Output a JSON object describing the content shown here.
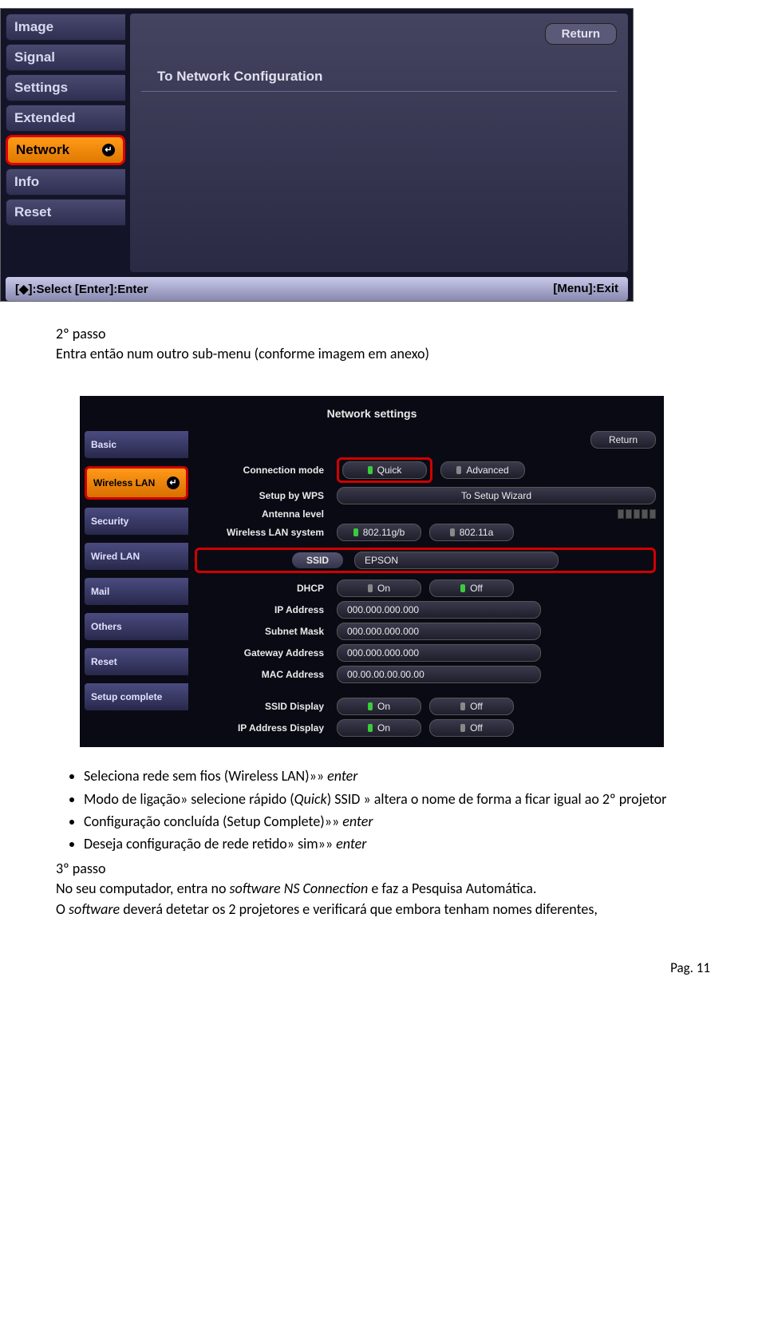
{
  "osd1": {
    "sidebar": [
      "Image",
      "Signal",
      "Settings",
      "Extended",
      "Network",
      "Info",
      "Reset"
    ],
    "selected_index": 4,
    "return_label": "Return",
    "to_network": "To Network Configuration",
    "footer_left": "[◆]:Select [Enter]:Enter",
    "footer_right": "[Menu]:Exit"
  },
  "doc": {
    "p2_title": "2º passo",
    "p2_line": "Entra então num outro sub-menu (conforme imagem em anexo)",
    "bullet1a": "Seleciona rede sem fios (Wireless LAN)»» ",
    "bullet1b": "enter",
    "bullet2a": "Modo de ligação» selecione rápido (",
    "bullet2b": "Quick",
    "bullet2c": ") SSID » altera o nome de forma a ficar igual ao 2º projetor",
    "bullet3a": "Configuração concluída (Setup Complete)»» ",
    "bullet3b": "enter",
    "bullet4a": "Deseja configuração de rede retido» sim»» ",
    "bullet4b": "enter",
    "p3_title": "3º passo",
    "p3_l1a": "No seu computador, entra no ",
    "p3_l1b": "software NS Connection",
    "p3_l1c": " e faz a Pesquisa Automática.",
    "p3_l2a": "O ",
    "p3_l2b": "software",
    "p3_l2c": " deverá detetar os 2 projetores e verificará que embora tenham nomes diferentes,",
    "page": "Pag. 11"
  },
  "osd2": {
    "title": "Network settings",
    "return_label": "Return",
    "sidebar": [
      "Basic",
      "Wireless LAN",
      "Security",
      "Wired LAN",
      "Mail",
      "Others",
      "Reset",
      "Setup complete"
    ],
    "selected_index": 1,
    "rows": {
      "conn_mode": {
        "label": "Connection mode",
        "opt1": "Quick",
        "opt2": "Advanced"
      },
      "wps": {
        "label": "Setup by WPS",
        "btn": "To Setup Wizard"
      },
      "antenna": {
        "label": "Antenna level"
      },
      "wlan_sys": {
        "label": "Wireless LAN system",
        "opt1": "802.11g/b",
        "opt2": "802.11a"
      },
      "ssid": {
        "label": "SSID",
        "value": "EPSON"
      },
      "dhcp": {
        "label": "DHCP",
        "on": "On",
        "off": "Off"
      },
      "ip": {
        "label": "IP Address",
        "value": "000.000.000.000"
      },
      "subnet": {
        "label": "Subnet Mask",
        "value": "000.000.000.000"
      },
      "gateway": {
        "label": "Gateway Address",
        "value": "000.000.000.000"
      },
      "mac": {
        "label": "MAC Address",
        "value": "00.00.00.00.00.00"
      },
      "ssid_disp": {
        "label": "SSID Display",
        "on": "On",
        "off": "Off"
      },
      "ip_disp": {
        "label": "IP Address Display",
        "on": "On",
        "off": "Off"
      }
    }
  }
}
